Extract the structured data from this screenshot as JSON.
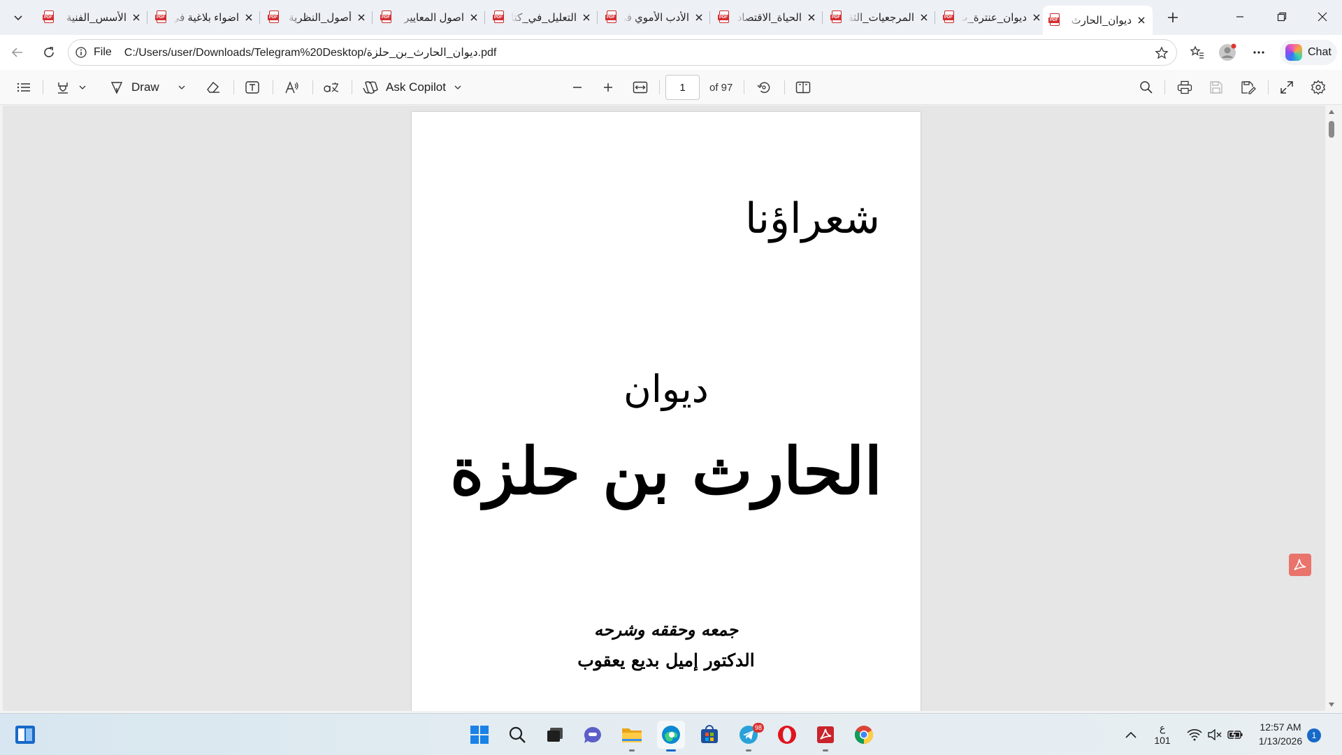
{
  "browser": {
    "tabs": [
      {
        "title": "الأسس_الفنية",
        "icon": "pdf-icon",
        "active": false
      },
      {
        "title": "اضواء بلاغية في",
        "icon": "pdf-icon",
        "active": false
      },
      {
        "title": "أصول_النظرية",
        "icon": "pdf-icon",
        "active": false
      },
      {
        "title": "اصول المعايير",
        "icon": "pdf-icon",
        "active": false
      },
      {
        "title": "التعليل_في_كتاب",
        "icon": "pdf-icon",
        "active": false
      },
      {
        "title": "الأدب الأموي في",
        "icon": "pdf-icon",
        "active": false
      },
      {
        "title": "الحياة_الاقتصادية",
        "icon": "pdf-icon",
        "active": false
      },
      {
        "title": "المرجعيات_الثقافية",
        "icon": "pdf-icon",
        "active": false
      },
      {
        "title": "ديوان_عنترة_ت",
        "icon": "pdf-icon",
        "active": false
      },
      {
        "title": "ديوان_الحارث",
        "icon": "pdf-icon",
        "active": true
      }
    ],
    "address": {
      "scheme_label": "File",
      "url": "C:/Users/user/Downloads/Telegram%20Desktop/ديوان_الحارث_بن_حلزة.pdf"
    },
    "chat_label": "Chat"
  },
  "pdf_toolbar": {
    "draw_label": "Draw",
    "ask_copilot_label": "Ask Copilot",
    "current_page": "1",
    "page_count": "of 97"
  },
  "document": {
    "series_title": "شعراؤنا",
    "diwan_word": "ديوان",
    "poet_name": "الحارث بن حلزة",
    "compiled_line": "جمعه وحققه وشرحه",
    "editor": "الدكتور إميل بديع يعقوب"
  },
  "taskbar": {
    "apps": [
      "start-icon",
      "search-icon",
      "task-view-icon",
      "chat-icon",
      "file-explorer-icon",
      "edge-icon",
      "store-icon",
      "telegram-icon",
      "opera-icon",
      "pdf-reader-icon",
      "chrome-icon"
    ],
    "telegram_badge": "98",
    "keyboard_lang": "ع",
    "keyboard_sub": "101",
    "time": "12:57 AM",
    "date": "1/13/2026",
    "notification_count": "1"
  },
  "colors": {
    "accent": "#1769c8",
    "pdf_red": "#d42e31",
    "acrobat_float": "#e8746c",
    "tab_strip_bg": "#edf0f5"
  }
}
